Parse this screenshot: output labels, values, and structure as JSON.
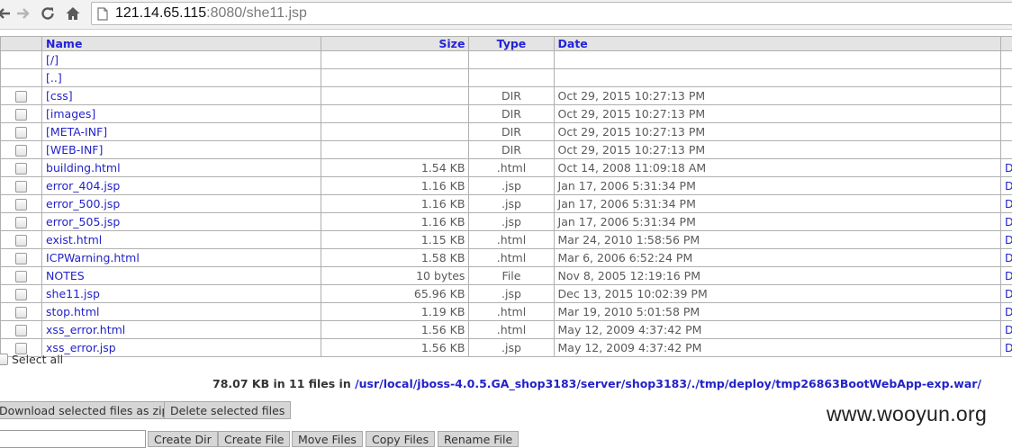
{
  "browser": {
    "url_host": "121.14.65.115",
    "url_rest": ":8080/she11.jsp",
    "icons": [
      "back-arrow-icon",
      "forward-arrow-icon",
      "reload-icon",
      "home-icon",
      "page-icon"
    ]
  },
  "table": {
    "headers": {
      "name": "Name",
      "size": "Size",
      "type": "Type",
      "date": "Date"
    },
    "rows": [
      {
        "checkbox": false,
        "name": "[/]",
        "size": "",
        "type": "",
        "date": "",
        "action": ""
      },
      {
        "checkbox": false,
        "name": "[..]",
        "size": "",
        "type": "",
        "date": "",
        "action": ""
      },
      {
        "checkbox": true,
        "name": "[css]",
        "size": "",
        "type": "DIR",
        "date": "Oct 29, 2015 10:27:13 PM",
        "action": ""
      },
      {
        "checkbox": true,
        "name": "[images]",
        "size": "",
        "type": "DIR",
        "date": "Oct 29, 2015 10:27:13 PM",
        "action": ""
      },
      {
        "checkbox": true,
        "name": "[META-INF]",
        "size": "",
        "type": "DIR",
        "date": "Oct 29, 2015 10:27:13 PM",
        "action": ""
      },
      {
        "checkbox": true,
        "name": "[WEB-INF]",
        "size": "",
        "type": "DIR",
        "date": "Oct 29, 2015 10:27:13 PM",
        "action": ""
      },
      {
        "checkbox": true,
        "name": "building.html",
        "size": "1.54 KB",
        "type": ".html",
        "date": "Oct 14, 2008 11:09:18 AM",
        "action": "Do"
      },
      {
        "checkbox": true,
        "name": "error_404.jsp",
        "size": "1.16 KB",
        "type": ".jsp",
        "date": "Jan 17, 2006 5:31:34 PM",
        "action": "Do"
      },
      {
        "checkbox": true,
        "name": "error_500.jsp",
        "size": "1.16 KB",
        "type": ".jsp",
        "date": "Jan 17, 2006 5:31:34 PM",
        "action": "Do"
      },
      {
        "checkbox": true,
        "name": "error_505.jsp",
        "size": "1.16 KB",
        "type": ".jsp",
        "date": "Jan 17, 2006 5:31:34 PM",
        "action": "Do"
      },
      {
        "checkbox": true,
        "name": "exist.html",
        "size": "1.15 KB",
        "type": ".html",
        "date": "Mar 24, 2010 1:58:56 PM",
        "action": "Do"
      },
      {
        "checkbox": true,
        "name": "ICPWarning.html",
        "size": "1.58 KB",
        "type": ".html",
        "date": "Mar 6, 2006 6:52:24 PM",
        "action": "Do"
      },
      {
        "checkbox": true,
        "name": "NOTES",
        "size": "10 bytes",
        "type": "File",
        "date": "Nov 8, 2005 12:19:16 PM",
        "action": "Do"
      },
      {
        "checkbox": true,
        "name": "she11.jsp",
        "size": "65.96 KB",
        "type": ".jsp",
        "date": "Dec 13, 2015 10:02:39 PM",
        "action": "Do"
      },
      {
        "checkbox": true,
        "name": "stop.html",
        "size": "1.19 KB",
        "type": ".html",
        "date": "Mar 19, 2010 5:01:58 PM",
        "action": "Do"
      },
      {
        "checkbox": true,
        "name": "xss_error.html",
        "size": "1.56 KB",
        "type": ".html",
        "date": "May 12, 2009 4:37:42 PM",
        "action": "Do"
      },
      {
        "checkbox": true,
        "name": "xss_error.jsp",
        "size": "1.56 KB",
        "type": ".jsp",
        "date": "May 12, 2009 4:37:42 PM",
        "action": "Do"
      }
    ]
  },
  "select_all_label": "Select all",
  "summary": {
    "text": "78.07 KB in 11 files in ",
    "path": "/usr/local/jboss-4.0.5.GA_shop3183/server/shop3183/./tmp/deploy/tmp26863BootWebApp-exp.war/"
  },
  "buttons": {
    "zip": "Download selected files as zip",
    "delete": "Delete selected files",
    "create_dir": "Create Dir",
    "create_file": "Create File",
    "move_files": "Move Files",
    "copy_files": "Copy Files",
    "rename_file": "Rename File"
  },
  "watermark": "www.wooyun.org"
}
